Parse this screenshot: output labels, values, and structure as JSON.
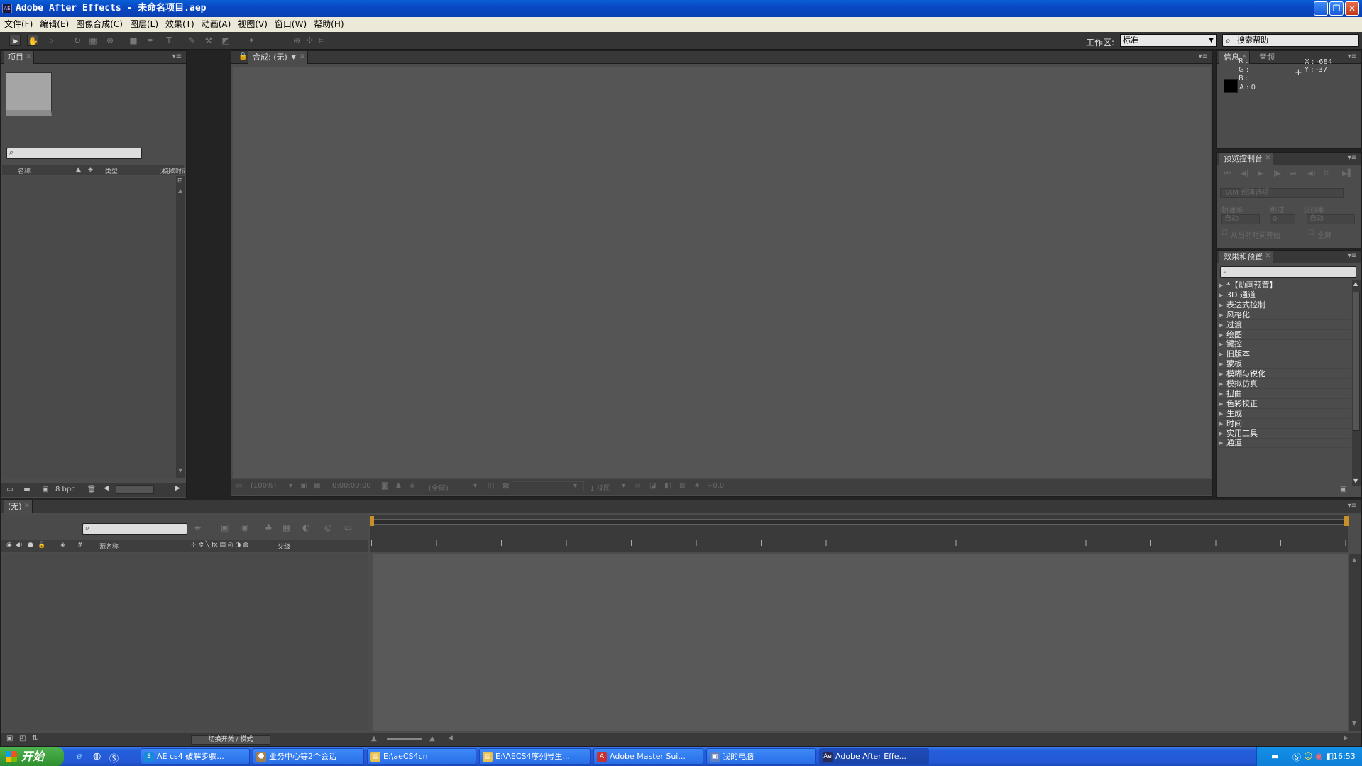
{
  "window": {
    "title": "Adobe After Effects - 未命名项目.aep",
    "app_icon": "AE"
  },
  "menu": [
    "文件(F)",
    "编辑(E)",
    "图像合成(C)",
    "图层(L)",
    "效果(T)",
    "动画(A)",
    "视图(V)",
    "窗口(W)",
    "帮助(H)"
  ],
  "toolbar": {
    "workspace_label": "工作区:",
    "workspace_value": "标准",
    "help_placeholder": "搜索帮助"
  },
  "project": {
    "tab": "项目",
    "columns": {
      "name": "名称",
      "type": "类型",
      "size": "大小",
      "duration": "持续时间"
    },
    "bpc": "8 bpc"
  },
  "composition": {
    "tab": "合成: (无)",
    "footer": {
      "zoom": "(100%)",
      "timecode": "0:00:00:00",
      "resolution": "(全屏)",
      "views": "1 视图",
      "exposure": "+0.0"
    }
  },
  "info": {
    "tabs": [
      "信息",
      "音频"
    ],
    "r": "R :",
    "g": "G :",
    "b": "B :",
    "a": "A : 0",
    "x": "X : -684",
    "y": "Y : -37"
  },
  "preview": {
    "tab": "预览控制台",
    "ram_options": "RAM 预演选项",
    "frame_rate_label": "帧速率",
    "skip_label": "跳过",
    "resolution_label": "分辨率",
    "frame_rate_value": "自动",
    "skip_value": "0",
    "resolution_value": "自动",
    "from_current": "从当前时间开始",
    "full_screen": "全屏"
  },
  "effects": {
    "tab": "效果和预置",
    "items": [
      "*【动画预置】",
      "3D 通道",
      "表达式控制",
      "风格化",
      "过渡",
      "绘图",
      "键控",
      "旧版本",
      "蒙板",
      "模糊与锐化",
      "模拟仿真",
      "扭曲",
      "色彩校正",
      "生成",
      "时间",
      "实用工具",
      "通道"
    ]
  },
  "timeline": {
    "tab": "(无)",
    "columns": {
      "number": "#",
      "source_name": "源名称",
      "parent": "父级"
    },
    "switch_modes": "切换开关 / 模式"
  },
  "taskbar": {
    "start": "开始",
    "buttons": [
      {
        "label": "AE cs4 破解步骤...",
        "icon": "S",
        "color": "#1a8ad8"
      },
      {
        "label": "业务中心等2个会话",
        "icon": "☻",
        "color": "#a08050"
      },
      {
        "label": "E:\\aeCS4cn",
        "icon": "▤",
        "color": "#e8c050"
      },
      {
        "label": "E:\\AECS4序列号生...",
        "icon": "▤",
        "color": "#e8c050"
      },
      {
        "label": "Adobe Master Sui...",
        "icon": "A",
        "color": "#c83030"
      },
      {
        "label": "我的电脑",
        "icon": "▣",
        "color": "#6080c0"
      },
      {
        "label": "Adobe After Effe...",
        "icon": "Ae",
        "color": "#2a2a5a"
      }
    ],
    "clock": "16:53"
  }
}
